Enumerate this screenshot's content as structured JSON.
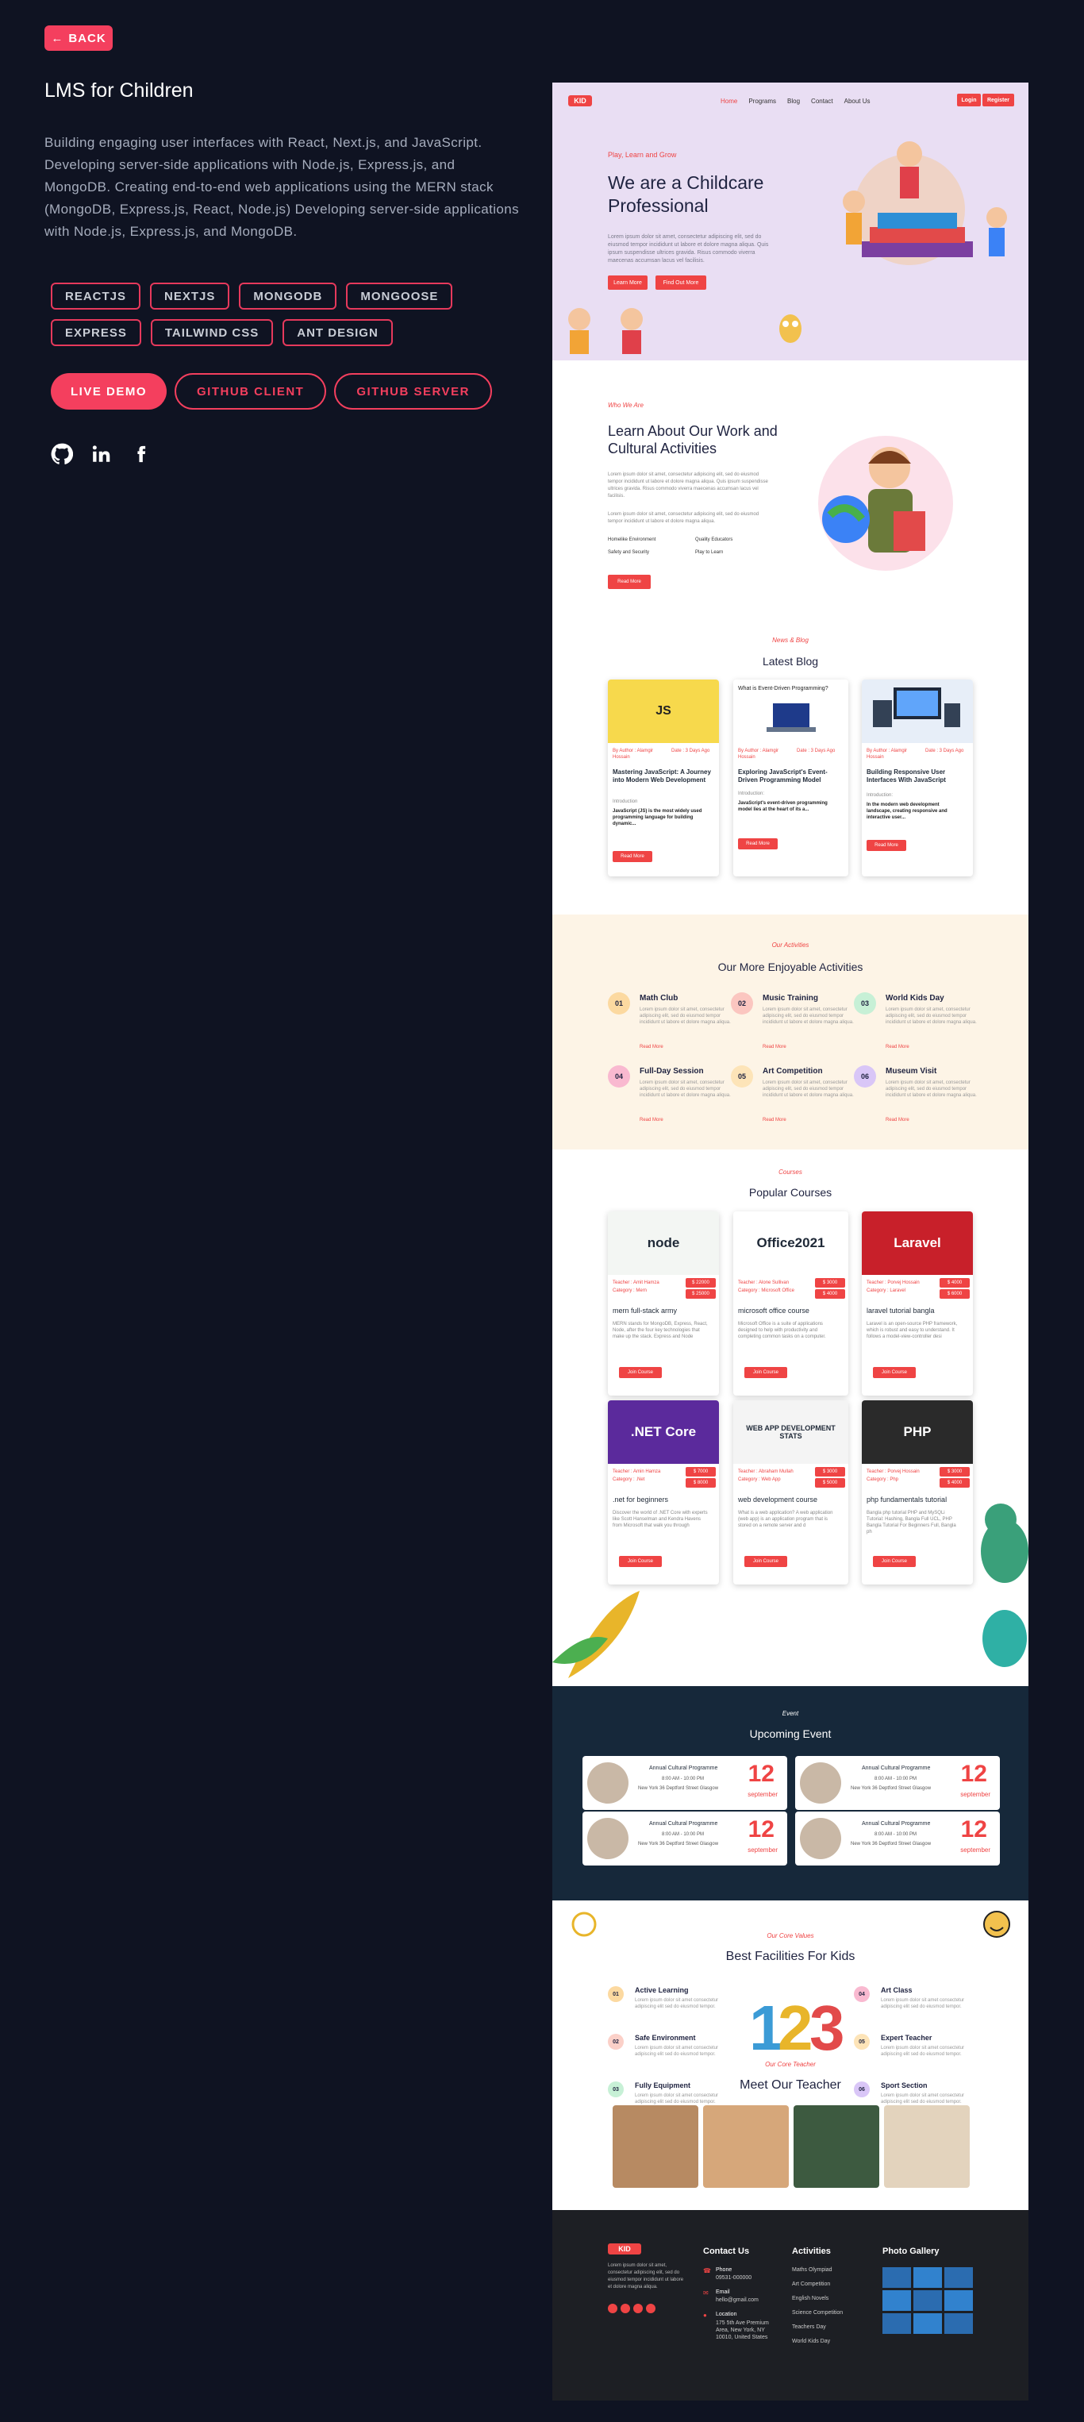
{
  "back_label": "BACK",
  "project": {
    "title": "LMS for Children",
    "description": "Building engaging user interfaces with React, Next.js, and JavaScript. Developing server-side applications with Node.js, Express.js, and MongoDB. Creating end-to-end web applications using the MERN stack (MongoDB, Express.js, React, Node.js) Developing server-side applications with Node.js, Express.js, and MongoDB.",
    "tags": [
      "REACTJS",
      "NEXTJS",
      "MONGODB",
      "MONGOOSE",
      "EXPRESS",
      "TAILWIND CSS",
      "ANT DESIGN"
    ],
    "buttons": {
      "live": "LIVE DEMO",
      "client": "GITHUB CLIENT",
      "server": "GITHUB SERVER"
    },
    "socials": [
      "github-icon",
      "linkedin-icon",
      "facebook-icon"
    ]
  },
  "preview": {
    "nav": {
      "logo": "KID",
      "items": [
        "Home",
        "Programs",
        "Blog",
        "Contact",
        "About Us"
      ],
      "login": "Login",
      "register": "Register"
    },
    "hero": {
      "subtitle": "Play, Learn and Grow",
      "title": "We are a Childcare Professional",
      "text": "Lorem ipsum dolor sit amet, consectetur adipiscing elit, sed do eiusmod tempor incididunt ut labore et dolore magna aliqua. Quis ipsum suspendisse ultrices gravida. Risus commodo viverra maecenas accumsan lacus vel facilisis.",
      "btn1": "Learn More",
      "btn2": "Find Out More"
    },
    "about": {
      "subtitle": "Who We Are",
      "title": "Learn About Our Work and Cultural Activities",
      "text1": "Lorem ipsum dolor sit amet, consectetur adipiscing elit, sed do eiusmod tempor incididunt ut labore et dolore magna aliqua. Quis ipsum suspendisse ultrices gravida. Risus commodo viverra maecenas accumsan lacus vel facilisis.",
      "text2": "Lorem ipsum dolor sit amet, consectetur adipiscing elit, sed do eiusmod tempor incididunt ut labore et dolore magna aliqua.",
      "features": [
        "Homelike Environment",
        "Quality Educators",
        "Safety and Security",
        "Play to Learn"
      ],
      "btn": "Read More"
    },
    "blog": {
      "subtitle": "News & Blog",
      "title": "Latest Blog",
      "posts": [
        {
          "author": "By Author : Alamgir Hossain",
          "date": "Date : 3 Days Ago",
          "title": "Mastering JavaScript: A Journey into Modern Web Development",
          "intro": "Introduction",
          "text": "JavaScript (JS) is the most widely used programming language for building dynamic...",
          "btn": "Read More"
        },
        {
          "author": "By Author : Alamgir Hossain",
          "date": "Date : 3 Days Ago",
          "title": "Exploring JavaScript's Event-Driven Programming Model",
          "intro": "Introduction:",
          "text": "JavaScript's event-driven programming model lies at the heart of its a...",
          "btn": "Read More",
          "header": "What is Event-Driven Programming?"
        },
        {
          "author": "By Author : Alamgir Hossain",
          "date": "Date : 3 Days Ago",
          "title": "Building Responsive User Interfaces With JavaScript",
          "intro": "Introduction:",
          "text": "In the modern web development landscape, creating responsive and interactive user...",
          "btn": "Read More"
        }
      ]
    },
    "activities": {
      "subtitle": "Our Activities",
      "title": "Our More Enjoyable Activities",
      "text": "Lorem ipsum dolor sit amet, consectetur adipiscing elit, sed do eiusmod tempor incididunt ut labore et dolore magna aliqua.",
      "more": "Read More",
      "items": [
        {
          "num": "01",
          "title": "Math Club",
          "color": "#fcd9a0"
        },
        {
          "num": "02",
          "title": "Music Training",
          "color": "#fbc6c0"
        },
        {
          "num": "03",
          "title": "World Kids Day",
          "color": "#c7f0d6"
        },
        {
          "num": "04",
          "title": "Full-Day Session",
          "color": "#f9b9d0"
        },
        {
          "num": "05",
          "title": "Art Competition",
          "color": "#fde4b8"
        },
        {
          "num": "06",
          "title": "Museum Visit",
          "color": "#d9c6f7"
        }
      ]
    },
    "courses": {
      "subtitle": "Courses",
      "title": "Popular Courses",
      "btn": "Join Course",
      "items": [
        {
          "teacher": "Teacher : Amit Hamza",
          "category": "Category : Mern",
          "price1": "$ 22000",
          "price2": "$ 25000",
          "title": "mern full-stack army",
          "text": "MERN stands for MongoDB, Express, React, Node, after the four key technologies that make up the stack. Express and Node",
          "banner": "node",
          "bg": "#f3f6f3"
        },
        {
          "teacher": "Teacher : Alone Sullivan",
          "category": "Category : Microsoft Office",
          "price1": "$ 3000",
          "price2": "$ 4000",
          "title": "microsoft office course",
          "text": "Microsoft Office is a suite of applications designed to help with productivity and completing common tasks on a computer.",
          "banner": "Office2021",
          "bg": "#ffffff"
        },
        {
          "teacher": "Teacher : Porvej Hossain",
          "category": "Category : Laravel",
          "price1": "$ 4000",
          "price2": "$ 6000",
          "title": "laravel tutorial bangla",
          "text": "Laravel is an open-source PHP framework, which is robust and easy to understand. It follows a model-view-controller desi",
          "banner": "Laravel",
          "bg": "#c8202a"
        },
        {
          "teacher": "Teacher : Amin Hamza",
          "category": "Category : .Net",
          "price1": "$ 7000",
          "price2": "$ 8000",
          "title": ".net for beginners",
          "text": "Discover the world of .NET Core with experts like Scott Hanselman and Kendra Havens from Microsoft that walk you through",
          "banner": ".NET Core",
          "bg": "#5b2a9c"
        },
        {
          "teacher": "Teacher : Abraham Mullah",
          "category": "Category : Web App",
          "price1": "$ 3000",
          "price2": "$ 5000",
          "title": "web development course",
          "text": "What is a web application? A web application (web app) is an application program that is stored on a remote server and d",
          "banner": "WEB APP DEVELOPMENT STATS",
          "bg": "#f4f4f4"
        },
        {
          "teacher": "Teacher : Porvej Hossain",
          "category": "Category : Php",
          "price1": "$ 3000",
          "price2": "$ 4000",
          "title": "php fundamentals tutorial",
          "text": "Bangla php tutorial PHP and MySQLi Tutorial: Hashing, Bangla Full UCL, PHP Bangla Tutorial For Beginners Full, Bangla ph",
          "banner": "PHP",
          "bg": "#2a2a2a"
        }
      ]
    },
    "events": {
      "subtitle": "Event",
      "title": "Upcoming Event",
      "items": [
        {
          "name": "Annual Cultural Programme",
          "time": "8:00 AM - 10:00 PM",
          "location": "New York 36 Deptford Street Glasgow",
          "date": "12",
          "month": "september"
        },
        {
          "name": "Annual Cultural Programme",
          "time": "8:00 AM - 10:00 PM",
          "location": "New York 36 Deptford Street Glasgow",
          "date": "12",
          "month": "september"
        },
        {
          "name": "Annual Cultural Programme",
          "time": "8:00 AM - 10:00 PM",
          "location": "New York 36 Deptford Street Glasgow",
          "date": "12",
          "month": "september"
        },
        {
          "name": "Annual Cultural Programme",
          "time": "8:00 AM - 10:00 PM",
          "location": "New York 36 Deptford Street Glasgow",
          "date": "12",
          "month": "september"
        }
      ]
    },
    "facilities": {
      "subtitle": "Our Core Values",
      "title": "Best Facilities For Kids",
      "text": "Lorem ipsum dolor sit amet consectetur adipiscing elit sed do eiusmod tempor.",
      "items": [
        {
          "num": "01",
          "title": "Active Learning",
          "color": "#fcd9a0"
        },
        {
          "num": "02",
          "title": "Safe Environment",
          "color": "#fbd0c8"
        },
        {
          "num": "03",
          "title": "Fully Equipment",
          "color": "#c7f0d6"
        },
        {
          "num": "04",
          "title": "Art Class",
          "color": "#f9b9d0"
        },
        {
          "num": "05",
          "title": "Expert Teacher",
          "color": "#fde4b8"
        },
        {
          "num": "06",
          "title": "Sport Section",
          "color": "#d9c6f7"
        }
      ]
    },
    "teachers": {
      "subtitle": "Our Core Teacher",
      "title": "Meet Our Teacher"
    },
    "footer": {
      "logo": "KID",
      "about": "Lorem ipsum dolor sit amet, consectetur adipiscing elit, sed do eiusmod tempor incididunt ut labore et dolore magna aliqua.",
      "contact_title": "Contact Us",
      "phone_label": "Phone",
      "phone": "09531-000000",
      "email_label": "Email",
      "email": "hello@gmail.com",
      "location_label": "Location",
      "location": "175 5th Ave Premium Area, New York, NY 10010, United States",
      "activities_title": "Activities",
      "activities": [
        "Maths Olympiad",
        "Art Competition",
        "English Novels",
        "Science Competition",
        "Teachers Day",
        "World Kids Day"
      ],
      "gallery_title": "Photo Gallery"
    }
  }
}
